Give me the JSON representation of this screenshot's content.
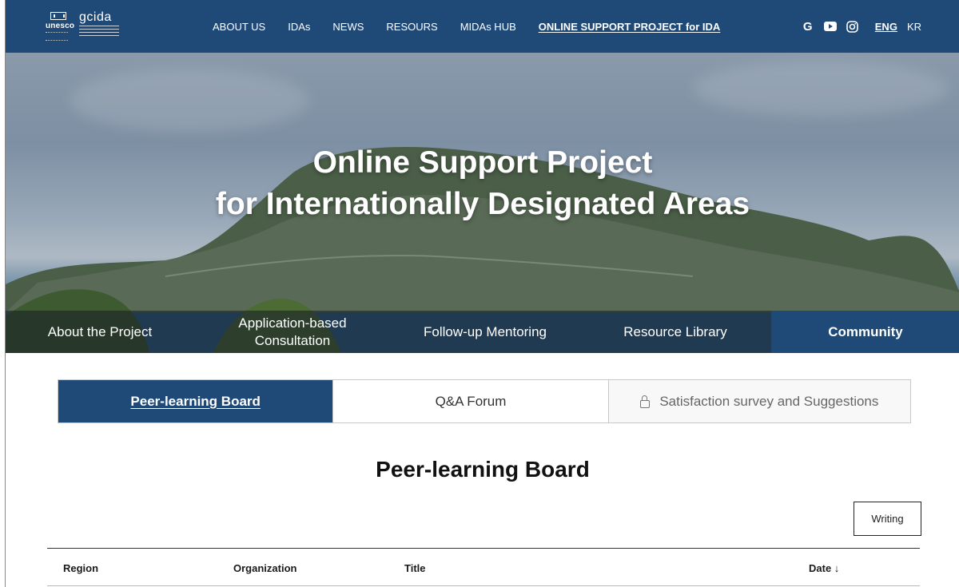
{
  "nav": {
    "logo_unesco": "unesco",
    "logo_gcida": "gcida",
    "links": [
      "ABOUT US",
      "IDAs",
      "NEWS",
      "RESOURS",
      "MIDAs HUB",
      "ONLINE SUPPORT PROJECT for IDA"
    ],
    "active_link": "ONLINE SUPPORT PROJECT for IDA",
    "social_icons": [
      "google-icon",
      "youtube-icon",
      "instagram-icon"
    ],
    "google_glyph": "G",
    "lang": {
      "eng": "ENG",
      "kr": "KR",
      "active": "ENG"
    }
  },
  "hero": {
    "title_line1": "Online Support Project",
    "title_line2": "for Internationally Designated Areas",
    "tabs": [
      "About the Project",
      "Application-based Consultation",
      "Follow-up Mentoring",
      "Resource Library",
      "Community"
    ],
    "active_tab": "Community"
  },
  "subtabs": {
    "items": [
      "Peer-learning Board",
      "Q&A Forum",
      "Satisfaction survey and Suggestions"
    ],
    "active": "Peer-learning Board"
  },
  "board": {
    "title": "Peer-learning Board",
    "write_button": "Writing",
    "columns": [
      "Region",
      "Organization",
      "Title",
      "Date ↓"
    ]
  },
  "colors": {
    "brand": "#1f4a78",
    "nav_text": "#ffffff"
  }
}
